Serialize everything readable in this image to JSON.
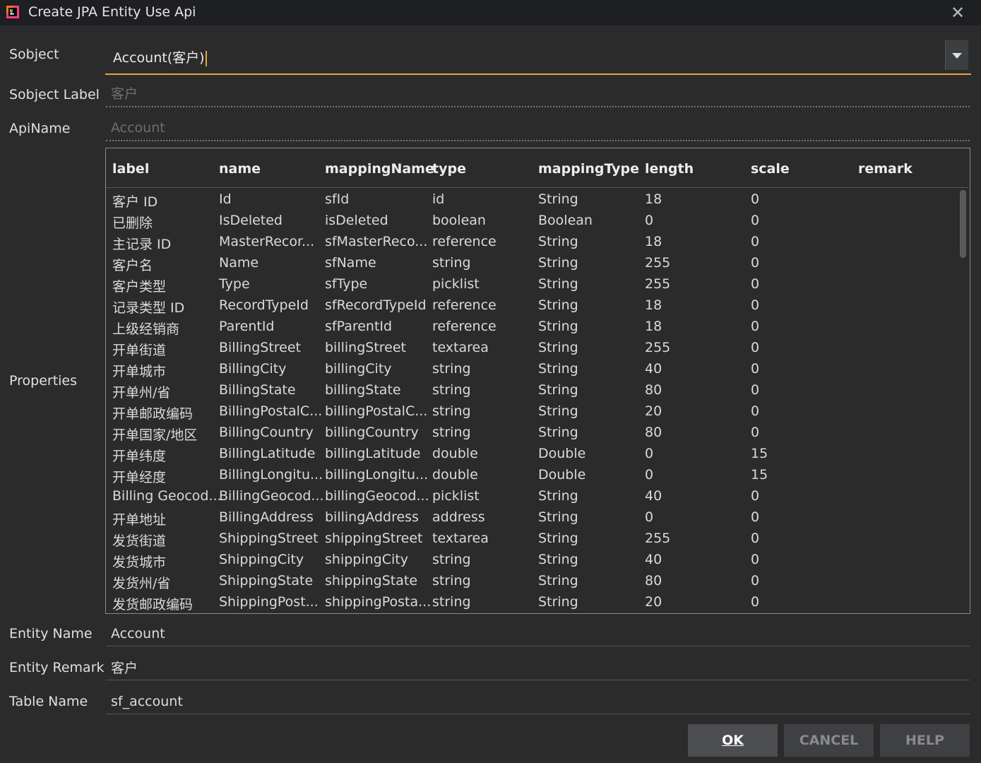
{
  "window": {
    "title": "Create JPA Entity Use Api",
    "close_icon": "close-icon"
  },
  "form": {
    "subject_label": "Sobject",
    "subject_value": "Account(客户)",
    "subject_label_label": "Sobject Label",
    "subject_label_placeholder": "客户",
    "api_name_label": "ApiName",
    "api_name_placeholder": "Account",
    "properties_label": "Properties",
    "entity_name_label": "Entity Name",
    "entity_name_value": "Account",
    "entity_remark_label": "Entity Remark",
    "entity_remark_value": "客户",
    "table_name_label": "Table Name",
    "table_name_value": "sf_account"
  },
  "table": {
    "columns": [
      "label",
      "name",
      "mappingName",
      "type",
      "mappingType",
      "length",
      "scale",
      "remark"
    ],
    "rows": [
      [
        "客户 ID",
        "Id",
        "sfId",
        "id",
        "String",
        "18",
        "0",
        ""
      ],
      [
        "已删除",
        "IsDeleted",
        "isDeleted",
        "boolean",
        "Boolean",
        "0",
        "0",
        ""
      ],
      [
        "主记录 ID",
        "MasterRecor...",
        "sfMasterReco...",
        "reference",
        "String",
        "18",
        "0",
        ""
      ],
      [
        "客户名",
        "Name",
        "sfName",
        "string",
        "String",
        "255",
        "0",
        ""
      ],
      [
        "客户类型",
        "Type",
        "sfType",
        "picklist",
        "String",
        "255",
        "0",
        ""
      ],
      [
        "记录类型 ID",
        "RecordTypeId",
        "sfRecordTypeId",
        "reference",
        "String",
        "18",
        "0",
        ""
      ],
      [
        "上级经销商",
        "ParentId",
        "sfParentId",
        "reference",
        "String",
        "18",
        "0",
        ""
      ],
      [
        "开单街道",
        "BillingStreet",
        "billingStreet",
        "textarea",
        "String",
        "255",
        "0",
        ""
      ],
      [
        "开单城市",
        "BillingCity",
        "billingCity",
        "string",
        "String",
        "40",
        "0",
        ""
      ],
      [
        "开单州/省",
        "BillingState",
        "billingState",
        "string",
        "String",
        "80",
        "0",
        ""
      ],
      [
        "开单邮政编码",
        "BillingPostalC...",
        "billingPostalC...",
        "string",
        "String",
        "20",
        "0",
        ""
      ],
      [
        "开单国家/地区",
        "BillingCountry",
        "billingCountry",
        "string",
        "String",
        "80",
        "0",
        ""
      ],
      [
        "开单纬度",
        "BillingLatitude",
        "billingLatitude",
        "double",
        "Double",
        "0",
        "15",
        ""
      ],
      [
        "开单经度",
        "BillingLongitu...",
        "billingLongitu...",
        "double",
        "Double",
        "0",
        "15",
        ""
      ],
      [
        "Billing Geocod...",
        "BillingGeocod...",
        "billingGeocod...",
        "picklist",
        "String",
        "40",
        "0",
        ""
      ],
      [
        "开单地址",
        "BillingAddress",
        "billingAddress",
        "address",
        "String",
        "0",
        "0",
        ""
      ],
      [
        "发货街道",
        "ShippingStreet",
        "shippingStreet",
        "textarea",
        "String",
        "255",
        "0",
        ""
      ],
      [
        "发货城市",
        "ShippingCity",
        "shippingCity",
        "string",
        "String",
        "40",
        "0",
        ""
      ],
      [
        "发货州/省",
        "ShippingState",
        "shippingState",
        "string",
        "String",
        "80",
        "0",
        ""
      ],
      [
        "发货邮政编码",
        "ShippingPost...",
        "shippingPosta...",
        "string",
        "String",
        "20",
        "0",
        ""
      ]
    ]
  },
  "buttons": {
    "ok": "OK",
    "cancel": "CANCEL",
    "help": "HELP"
  },
  "colors": {
    "accent": "#e8a33d",
    "background": "#2b2b2b",
    "titlebar": "#1e1f22"
  }
}
